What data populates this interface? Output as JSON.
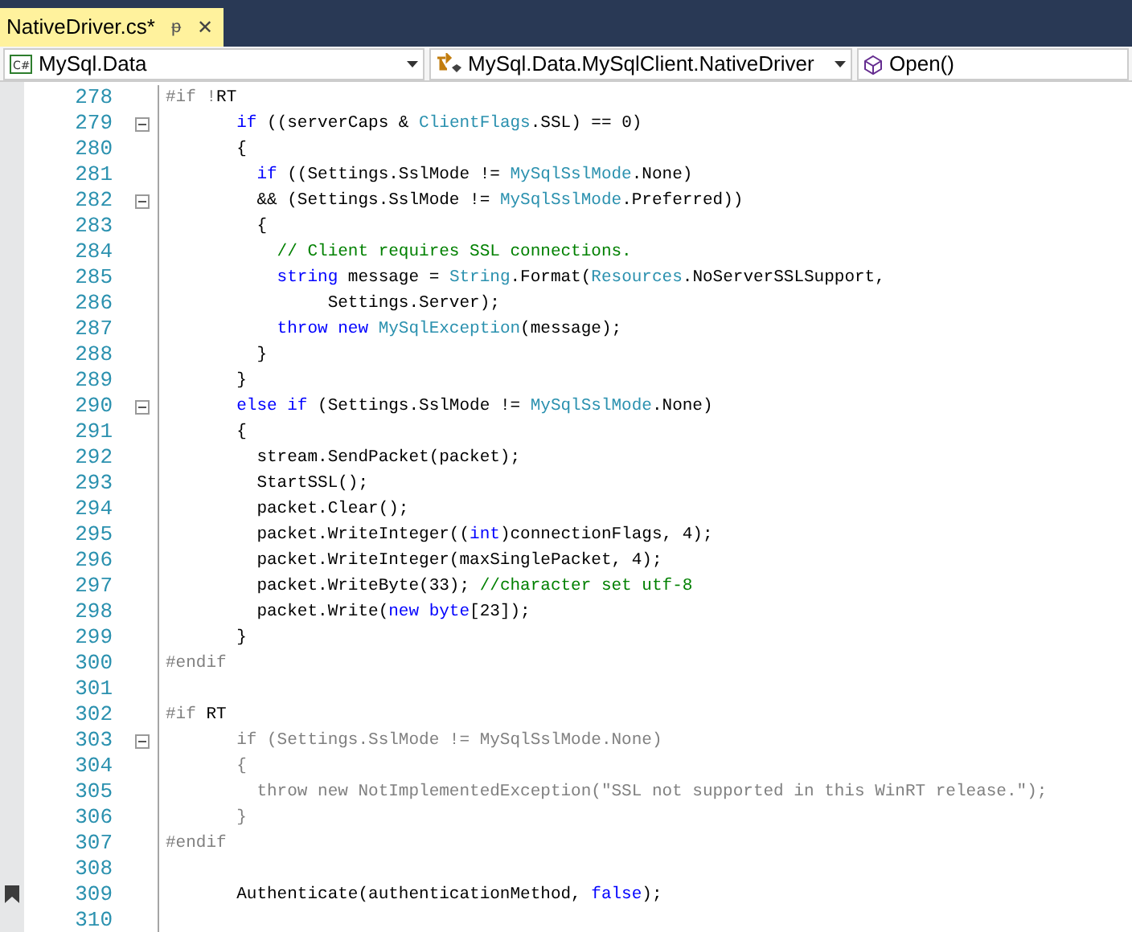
{
  "tab": {
    "title": "NativeDriver.cs*",
    "selected": true,
    "pin": "ᵽ",
    "close": "✕"
  },
  "navigation": [
    {
      "label": "MySql.Data",
      "kind": "project",
      "icon_text": "C#"
    },
    {
      "label": "MySql.Data.MySqlClient.NativeDriver",
      "kind": "class"
    },
    {
      "label": "Open()",
      "kind": "method"
    }
  ],
  "lines": [
    {
      "number": "278",
      "collapsible": false,
      "bookmark": false,
      "tokens": [
        {
          "text": "#if !",
          "kind": "pre"
        },
        {
          "text": "RT",
          "kind": "plain"
        }
      ]
    },
    {
      "number": "279",
      "collapsible": true,
      "bookmark": false,
      "tokens": [
        {
          "text": "       if",
          "kind": "keyword"
        },
        {
          "text": " ((serverCaps & ",
          "kind": "plain"
        },
        {
          "text": "ClientFlags",
          "kind": "type"
        },
        {
          "text": ".SSL) == 0)",
          "kind": "plain"
        }
      ]
    },
    {
      "number": "280",
      "collapsible": false,
      "bookmark": false,
      "tokens": [
        {
          "text": "       {",
          "kind": "plain"
        }
      ]
    },
    {
      "number": "281",
      "collapsible": false,
      "bookmark": false,
      "tokens": [
        {
          "text": "         if",
          "kind": "keyword"
        },
        {
          "text": " ((Settings.SslMode != ",
          "kind": "plain"
        },
        {
          "text": "MySqlSslMode",
          "kind": "type"
        },
        {
          "text": ".None)",
          "kind": "plain"
        }
      ]
    },
    {
      "number": "282",
      "collapsible": true,
      "bookmark": false,
      "tokens": [
        {
          "text": "         && (Settings.SslMode != ",
          "kind": "plain"
        },
        {
          "text": "MySqlSslMode",
          "kind": "type"
        },
        {
          "text": ".Preferred))",
          "kind": "plain"
        }
      ]
    },
    {
      "number": "283",
      "collapsible": false,
      "bookmark": false,
      "tokens": [
        {
          "text": "         {",
          "kind": "plain"
        }
      ]
    },
    {
      "number": "284",
      "collapsible": false,
      "bookmark": false,
      "tokens": [
        {
          "text": "           // Client requires SSL connections.",
          "kind": "comment"
        }
      ]
    },
    {
      "number": "285",
      "collapsible": false,
      "bookmark": false,
      "tokens": [
        {
          "text": "           string",
          "kind": "keyword"
        },
        {
          "text": " message = ",
          "kind": "plain"
        },
        {
          "text": "String",
          "kind": "type"
        },
        {
          "text": ".Format(",
          "kind": "plain"
        },
        {
          "text": "Resources",
          "kind": "type"
        },
        {
          "text": ".NoServerSSLSupport,",
          "kind": "plain"
        }
      ]
    },
    {
      "number": "286",
      "collapsible": false,
      "bookmark": false,
      "tokens": [
        {
          "text": "                Settings.Server);",
          "kind": "plain"
        }
      ]
    },
    {
      "number": "287",
      "collapsible": false,
      "bookmark": false,
      "tokens": [
        {
          "text": "           throw new ",
          "kind": "keyword"
        },
        {
          "text": "MySqlException",
          "kind": "type"
        },
        {
          "text": "(message);",
          "kind": "plain"
        }
      ]
    },
    {
      "number": "288",
      "collapsible": false,
      "bookmark": false,
      "tokens": [
        {
          "text": "         }",
          "kind": "plain"
        }
      ]
    },
    {
      "number": "289",
      "collapsible": false,
      "bookmark": false,
      "tokens": [
        {
          "text": "       }",
          "kind": "plain"
        }
      ]
    },
    {
      "number": "290",
      "collapsible": true,
      "bookmark": false,
      "tokens": [
        {
          "text": "       else if",
          "kind": "keyword"
        },
        {
          "text": " (Settings.SslMode != ",
          "kind": "plain"
        },
        {
          "text": "MySqlSslMode",
          "kind": "type"
        },
        {
          "text": ".None)",
          "kind": "plain"
        }
      ]
    },
    {
      "number": "291",
      "collapsible": false,
      "bookmark": false,
      "tokens": [
        {
          "text": "       {",
          "kind": "plain"
        }
      ]
    },
    {
      "number": "292",
      "collapsible": false,
      "bookmark": false,
      "tokens": [
        {
          "text": "         stream.SendPacket(packet);",
          "kind": "plain"
        }
      ]
    },
    {
      "number": "293",
      "collapsible": false,
      "bookmark": false,
      "tokens": [
        {
          "text": "         StartSSL();",
          "kind": "plain"
        }
      ]
    },
    {
      "number": "294",
      "collapsible": false,
      "bookmark": false,
      "tokens": [
        {
          "text": "         packet.Clear();",
          "kind": "plain"
        }
      ]
    },
    {
      "number": "295",
      "collapsible": false,
      "bookmark": false,
      "tokens": [
        {
          "text": "         packet.WriteInteger((",
          "kind": "plain"
        },
        {
          "text": "int",
          "kind": "keyword"
        },
        {
          "text": ")connectionFlags, 4);",
          "kind": "plain"
        }
      ]
    },
    {
      "number": "296",
      "collapsible": false,
      "bookmark": false,
      "tokens": [
        {
          "text": "         packet.WriteInteger(maxSinglePacket, 4);",
          "kind": "plain"
        }
      ]
    },
    {
      "number": "297",
      "collapsible": false,
      "bookmark": false,
      "tokens": [
        {
          "text": "         packet.WriteByte(33); ",
          "kind": "plain"
        },
        {
          "text": "//character set utf-8",
          "kind": "comment"
        }
      ]
    },
    {
      "number": "298",
      "collapsible": false,
      "bookmark": false,
      "tokens": [
        {
          "text": "         packet.Write(",
          "kind": "plain"
        },
        {
          "text": "new byte",
          "kind": "keyword"
        },
        {
          "text": "[23]);",
          "kind": "plain"
        }
      ]
    },
    {
      "number": "299",
      "collapsible": false,
      "bookmark": false,
      "tokens": [
        {
          "text": "       }",
          "kind": "plain"
        }
      ]
    },
    {
      "number": "300",
      "collapsible": false,
      "bookmark": false,
      "tokens": [
        {
          "text": "#endif",
          "kind": "pre"
        }
      ]
    },
    {
      "number": "301",
      "collapsible": false,
      "bookmark": false
    },
    {
      "number": "302",
      "collapsible": false,
      "bookmark": false,
      "tokens": [
        {
          "text": "#if ",
          "kind": "pre"
        },
        {
          "text": "RT",
          "kind": "plain"
        }
      ]
    },
    {
      "number": "303",
      "collapsible": true,
      "bookmark": false,
      "tokens": [
        {
          "text": "       if (Settings.SslMode != MySqlSslMode.None)",
          "kind": "inactive"
        }
      ]
    },
    {
      "number": "304",
      "collapsible": false,
      "bookmark": false,
      "tokens": [
        {
          "text": "       {",
          "kind": "inactive"
        }
      ]
    },
    {
      "number": "305",
      "collapsible": false,
      "bookmark": false,
      "tokens": [
        {
          "text": "         throw new NotImplementedException(\"SSL not supported in this WinRT release.\");",
          "kind": "inactive"
        }
      ]
    },
    {
      "number": "306",
      "collapsible": false,
      "bookmark": false,
      "tokens": [
        {
          "text": "       }",
          "kind": "inactive"
        }
      ]
    },
    {
      "number": "307",
      "collapsible": false,
      "bookmark": false,
      "tokens": [
        {
          "text": "#endif",
          "kind": "pre"
        }
      ]
    },
    {
      "number": "308",
      "collapsible": false,
      "bookmark": false
    },
    {
      "number": "309",
      "collapsible": false,
      "bookmark": true,
      "tokens": [
        {
          "text": "       Authenticate(authenticationMethod, ",
          "kind": "plain"
        },
        {
          "text": "false",
          "kind": "keyword"
        },
        {
          "text": ");",
          "kind": "plain"
        }
      ]
    },
    {
      "number": "310",
      "collapsible": false,
      "bookmark": false
    }
  ]
}
